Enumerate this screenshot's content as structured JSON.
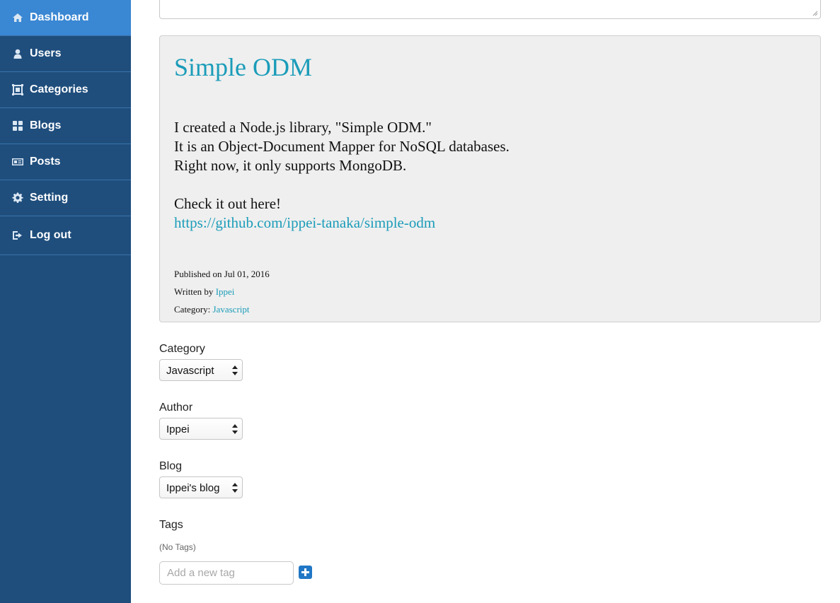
{
  "sidebar": {
    "items": [
      {
        "label": "Dashboard",
        "icon": "home-icon"
      },
      {
        "label": "Users",
        "icon": "user-icon"
      },
      {
        "label": "Categories",
        "icon": "categories-icon"
      },
      {
        "label": "Blogs",
        "icon": "grid-icon"
      },
      {
        "label": "Posts",
        "icon": "newspaper-icon"
      },
      {
        "label": "Setting",
        "icon": "gear-icon"
      },
      {
        "label": "Log out",
        "icon": "logout-icon"
      }
    ],
    "active": "Dashboard"
  },
  "preview": {
    "title": "Simple ODM",
    "body_lines": [
      "I created a Node.js library, \"Simple ODM.\"",
      "It is an Object-Document Mapper for NoSQL databases.",
      "Right now, it only supports MongoDB."
    ],
    "cta": "Check it out here!",
    "link": "https://github.com/ippei-tanaka/simple-odm",
    "published_text": "Published on Jul 01, 2016",
    "written_by_label": "Written by",
    "author": "Ippei",
    "category_label": "Category:",
    "category": "Javascript"
  },
  "form": {
    "category_label": "Category",
    "category_value": "Javascript",
    "author_label": "Author",
    "author_value": "Ippei",
    "blog_label": "Blog",
    "blog_value": "Ippei's blog",
    "tags_label": "Tags",
    "no_tags": "(No Tags)",
    "tag_placeholder": "Add a new tag"
  },
  "colors": {
    "sidebar_bg": "#1f4e7d",
    "sidebar_active": "#3a87d3",
    "link": "#1b9cb9",
    "add_button": "#2077c6"
  }
}
